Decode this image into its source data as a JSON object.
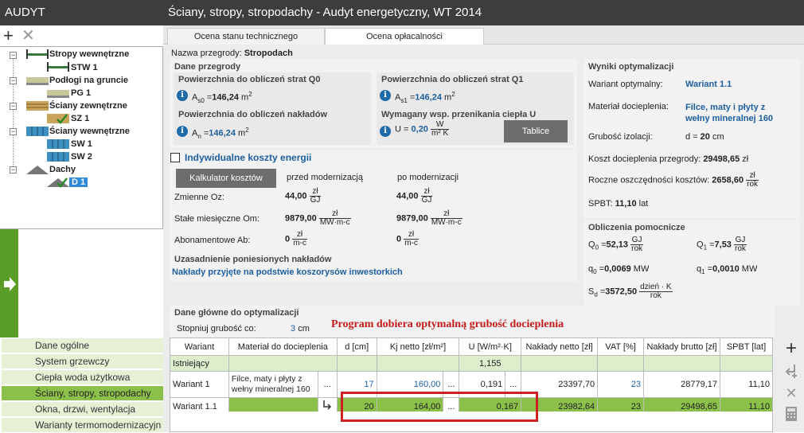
{
  "left": {
    "title": "AUDYT",
    "tree": [
      {
        "label": "Stropy wewnętrzne",
        "child": "STW 1"
      },
      {
        "label": "Podłogi na gruncie",
        "child": "PG 1"
      },
      {
        "label": "Ściany zewnętrzne",
        "child": "SZ 1"
      },
      {
        "label": "Ściany wewnętrzne",
        "child": "SW 1",
        "child2": "SW 2"
      },
      {
        "label": "Dachy",
        "child": "D 1"
      }
    ],
    "nav": [
      "Dane ogólne",
      "System grzewczy",
      "Ciepła woda użytkowa",
      "Ściany, stropy, stropodachy",
      "Okna, drzwi, wentylacja",
      "Warianty termomodernizacyjn"
    ]
  },
  "header": {
    "title": "Ściany, stropy, stropodachy - Audyt energetyczny, WT 2014"
  },
  "tabs": [
    "Ocena stanu technicznego",
    "Ocena opłacalności"
  ],
  "form": {
    "name_label": "Nazwa przegrody:",
    "name_value": "Stropodach",
    "dane_przegrody": "Dane przegrody",
    "q0_title": "Powierzchnia do obliczeń strat Q0",
    "q0_sym": "A",
    "q0_sub": "s0",
    "q0_eq": "=",
    "q0_value": "146,24",
    "q0_unit": "m",
    "q1_title": "Powierzchnia do obliczeń strat Q1",
    "q1_sym": "A",
    "q1_sub": "s1",
    "q1_eq": "=",
    "q1_value": "146,24",
    "q1_unit": "m",
    "nak_title": "Powierzchnia do obliczeń nakładów",
    "nak_sym": "A",
    "nak_sub": "n",
    "nak_eq": "=",
    "nak_value": "146,24",
    "nak_unit": "m",
    "sq": "2",
    "u_title": "Wymagany wsp. przenikania ciepła U",
    "u_sym": "U",
    "u_eq": "=",
    "u_value": "0,20",
    "u_num": "W",
    "u_den": "m² K",
    "tablice": "Tablice",
    "indiv": "Indywidualne koszty energii",
    "kalk": "Kalkulator kosztów",
    "przed": "przed modernizacją",
    "po": "po modernizacji",
    "zmienne": "Zmienne Oz:",
    "zm_before": "44,00",
    "zm_after": "44,00",
    "zm_num": "zł",
    "zm_den": "GJ",
    "stale": "Stałe miesięczne Om:",
    "st_before": "9879,00",
    "st_after": "9879,00",
    "st_num": "zł",
    "st_den": "MW·m-c",
    "abon": "Abonamentowe Ab:",
    "ab_before": "0",
    "ab_after": "0",
    "ab_num": "zł",
    "ab_den": "m-c",
    "uzas": "Uzasadnienie poniesionych nakładów",
    "uzas_text": "Nakłady przyjęte na podstwie koszorysów inwestorkich"
  },
  "wyniki": {
    "title": "Wyniki optymalizacji",
    "wariant_label": "Wariant optymalny:",
    "wariant_value": "Wariant 1.1",
    "material_label": "Materiał docieplenia:",
    "material_value": "Filce, maty i płyty z wełny mineralnej 160",
    "grubosc_label": "Grubość izolacji:",
    "grubosc_d": "d =",
    "grubosc_value": "20",
    "grubosc_unit": "cm",
    "koszt_label": "Koszt docieplenia przegrody:",
    "koszt_value": "29498,65",
    "koszt_unit": "zł",
    "oszcz_label": "Roczne oszczędności kosztów:",
    "oszcz_value": "2658,60",
    "oszcz_num": "zł",
    "oszcz_den": "rok",
    "spbt_label": "SPBT:",
    "spbt_value": "11,10",
    "spbt_unit": "lat"
  },
  "obliczenia": {
    "title": "Obliczenia pomocnicze",
    "q0_sym": "Q",
    "q0_sub": "0",
    "q0_value": "52,13",
    "q1_sym": "Q",
    "q1_sub": "1",
    "q1_value": "7,53",
    "gj": "GJ",
    "rok": "rok",
    "qq0_sym": "q",
    "qq0_sub": "0",
    "qq0_value": "0,0069",
    "qq1_sym": "q",
    "qq1_sub": "1",
    "qq1_value": "0,0010",
    "mw": "MW",
    "sd_sym": "S",
    "sd_sub": "d",
    "sd_value": "3572,50",
    "sd_num": "dzień · K",
    "sd_den": "rok",
    "eq": "="
  },
  "optym": {
    "title": "Dane główne do optymalizacji",
    "step_label": "Stopniuj grubość co:",
    "step_value": "3",
    "step_unit": "cm",
    "banner": "Program dobiera optymalną grubość docieplenia"
  },
  "grid": {
    "headers": [
      "Wariant",
      "Materiał do docieplenia",
      "d [cm]",
      "Kj netto [zł/m²]",
      "U [W/m²·K]",
      "Nakłady netto [zł]",
      "VAT [%]",
      "Nakłady brutto [zł]",
      "SPBT [lat]"
    ],
    "rows": [
      {
        "wariant": "Istniejący",
        "material": "",
        "d": "",
        "kj": "",
        "u": "1,155",
        "netto": "",
        "vat": "",
        "brutto": "",
        "spbt": ""
      },
      {
        "wariant": "Wariant 1",
        "material": "Filce, maty i płyty z wełny mineralnej 160",
        "d": "17",
        "kj": "160,00",
        "u": "0,191",
        "netto": "23397,70",
        "vat": "23",
        "brutto": "28779,17",
        "spbt": "11,10"
      },
      {
        "wariant": "Wariant 1.1",
        "material": "",
        "d": "20",
        "kj": "164,00",
        "u": "0,167",
        "netto": "23982,64",
        "vat": "23",
        "brutto": "29498,65",
        "spbt": "11,10"
      }
    ],
    "dots": "..."
  }
}
